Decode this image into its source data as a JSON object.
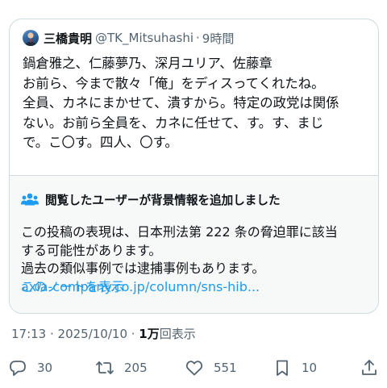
{
  "quoted_tweet": {
    "display_name": "三橋貴明",
    "handle": "@TK_Mitsuhashi",
    "separator": "·",
    "time": "9時間",
    "lines": [
      "鍋倉雅之、仁藤夢乃、深月ユリア、佐藤章",
      "お前ら、今まで散々「俺」をディスってくれたね。",
      "全員、カネにまかせて、潰すから。特定の政党は関係",
      "ない。お前ら全員を、カネに任せて、す。す、まじ",
      "で。こ〇す。四人、〇す。"
    ]
  },
  "community_note": {
    "title": "閲覧したユーザーが背景情報を追加しました",
    "lines": [
      "この投稿の表現は、日本刑法第 222 条の脅迫罪に該当",
      "する可能性があります。",
      "過去の類似事例では逮捕事例もあります。"
    ],
    "link": "axia-company.co.jp/column/sns-hib...",
    "show_note": "このノートを表示"
  },
  "meta": {
    "timestamp": "17:13 · 2025/10/10 · ",
    "views_count": "1万",
    "views_label": "回表示"
  },
  "actions": {
    "replies": "30",
    "reposts": "205",
    "likes": "551",
    "bookmarks": "10"
  },
  "icons": [
    "avatar",
    "people-icon",
    "reply-icon",
    "repost-icon",
    "like-icon",
    "bookmark-icon",
    "share-icon"
  ],
  "colors": {
    "text": "#0f1419",
    "secondary": "#536471",
    "link": "#1d9bf0",
    "border": "#cfd9de",
    "note_bg": "#f7f9f9"
  }
}
